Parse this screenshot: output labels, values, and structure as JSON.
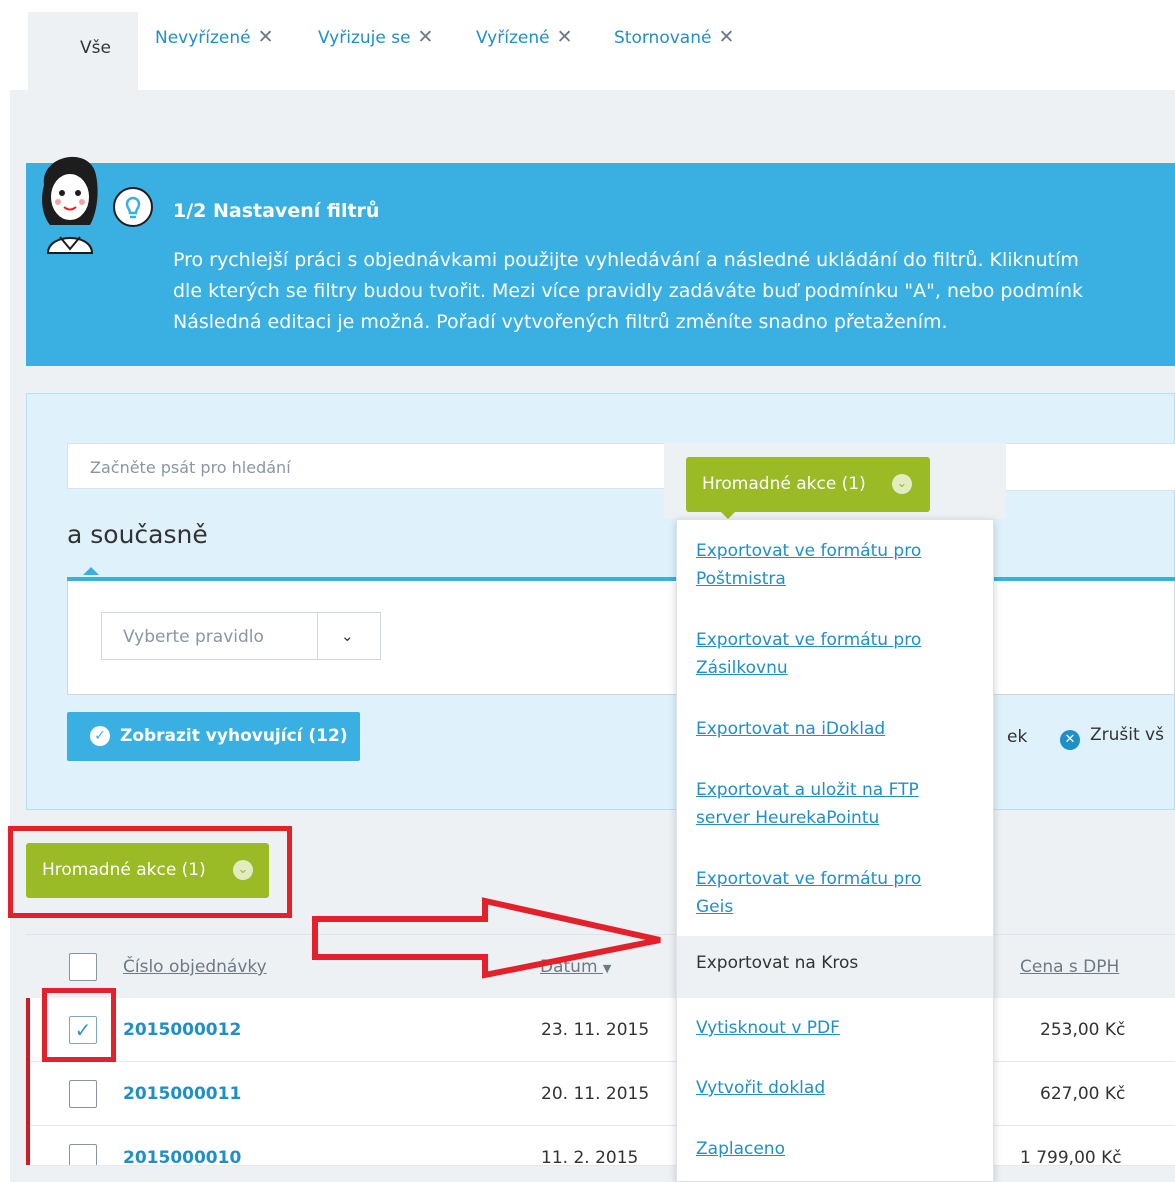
{
  "tabs": [
    {
      "label": "Vše",
      "active": true
    },
    {
      "label": "Nevyřízené",
      "closable": true
    },
    {
      "label": "Vyřizuje se",
      "closable": true
    },
    {
      "label": "Vyřízené",
      "closable": true
    },
    {
      "label": "Stornované",
      "closable": true
    }
  ],
  "close_glyph": "✕",
  "banner": {
    "title": "1/2  Nastavení filtrů",
    "lines": [
      "Pro rychlejší práci s objednávkami použijte vyhledávání a následné ukládání do filtrů. Kliknutím",
      "dle kterých se filtry budou tvořit. Mezi více pravidly zadáváte buď podmínku \"A\", nebo podmínk",
      "Následná editaci je možná. Pořadí vytvořených filtrů změníte snadno přetažením."
    ]
  },
  "filter": {
    "search_placeholder": "Začněte psát pro hledání",
    "and_label": "a současně",
    "rule_placeholder": "Vyberte pravidlo",
    "show_button": "Zobrazit vyhovující (12)",
    "partial_text": "ek",
    "cancel_all": "Zrušit vš"
  },
  "bulk_actions_label": "Hromadné akce (1)",
  "bulk_menu": {
    "items": [
      [
        "Exportovat ve formátu pro",
        "Poštmistra"
      ],
      [
        "Exportovat ve formátu pro",
        "Zásilkovnu"
      ],
      [
        "Exportovat na iDoklad"
      ],
      [
        "Exportovat a uložit na FTP",
        "server HeurekaPointu"
      ],
      [
        "Exportovat ve formátu pro",
        "Geis"
      ]
    ],
    "hovered": "Exportovat na Kros",
    "items_after": [
      "Vytisknout v PDF",
      "Vytvořit doklad",
      "Zaplaceno"
    ]
  },
  "table": {
    "headers": {
      "order_number": "Číslo objednávky",
      "date": "Datum",
      "price": "Cena s DPH"
    },
    "sort_glyph": "▼",
    "rows": [
      {
        "number": "2015000012",
        "date": "23. 11. 2015",
        "price": "253,00 Kč",
        "checked": true
      },
      {
        "number": "2015000011",
        "date": "20. 11. 2015",
        "price": "627,00 Kč",
        "checked": false
      },
      {
        "number": "2015000010",
        "date": "11. 2. 2015",
        "price": "1 799,00 Kč",
        "checked": false
      }
    ]
  },
  "colors": {
    "accent_blue": "#3ab0e2",
    "link_blue": "#1f8fc9",
    "green": "#9aba26",
    "annotation_red": "#e4202a"
  }
}
